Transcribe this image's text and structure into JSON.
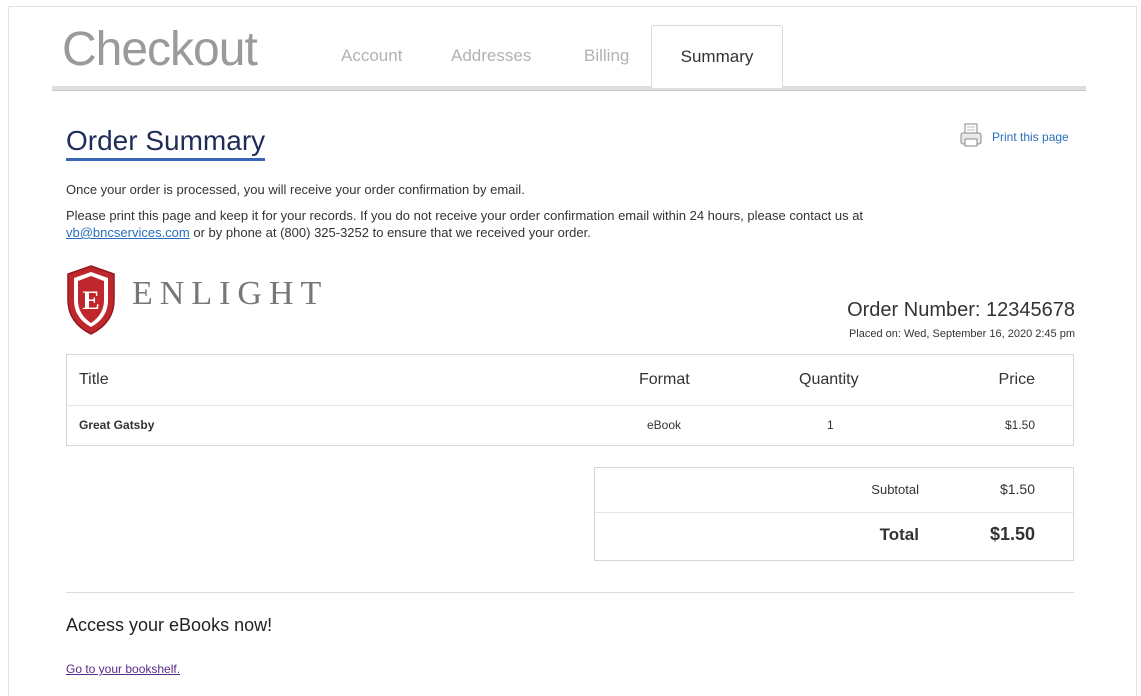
{
  "header": {
    "title": "Checkout",
    "tabs": [
      {
        "label": "Account"
      },
      {
        "label": "Addresses"
      },
      {
        "label": "Billing"
      },
      {
        "label": "Summary",
        "active": true
      }
    ]
  },
  "summary": {
    "heading": "Order Summary",
    "print_label": "Print this page",
    "line1": "Once your order is processed, you will receive your order confirmation by email.",
    "line2": "Please print this page and keep it for your records. If you do not receive your order confirmation email within 24 hours, please contact us at",
    "email": "vb@bncservices.com",
    "line3": "or by phone at (800) 325-3252 to ensure that we received your order."
  },
  "brand": {
    "logo_letter": "E",
    "logo_word": "ENLIGHT",
    "shield_color": "#c0272d"
  },
  "order": {
    "number": "Order Number: 12345678",
    "placed_on": "Placed on: Wed, September 16, 2020 2:45 pm"
  },
  "items_table": {
    "headers": {
      "title": "Title",
      "format": "Format",
      "quantity": "Quantity",
      "price": "Price"
    },
    "rows": [
      {
        "title": "Great Gatsby",
        "format": "eBook",
        "quantity": "1",
        "price": "$1.50"
      }
    ]
  },
  "totals": {
    "subtotal_label": "Subtotal",
    "subtotal_value": "$1.50",
    "total_label": "Total",
    "total_value": "$1.50"
  },
  "access": {
    "heading": "Access your eBooks now!",
    "link": "Go to your bookshelf."
  },
  "colors": {
    "link": "#2a6ebb",
    "heading": "#1f2d59",
    "underline": "#3a64b8"
  }
}
